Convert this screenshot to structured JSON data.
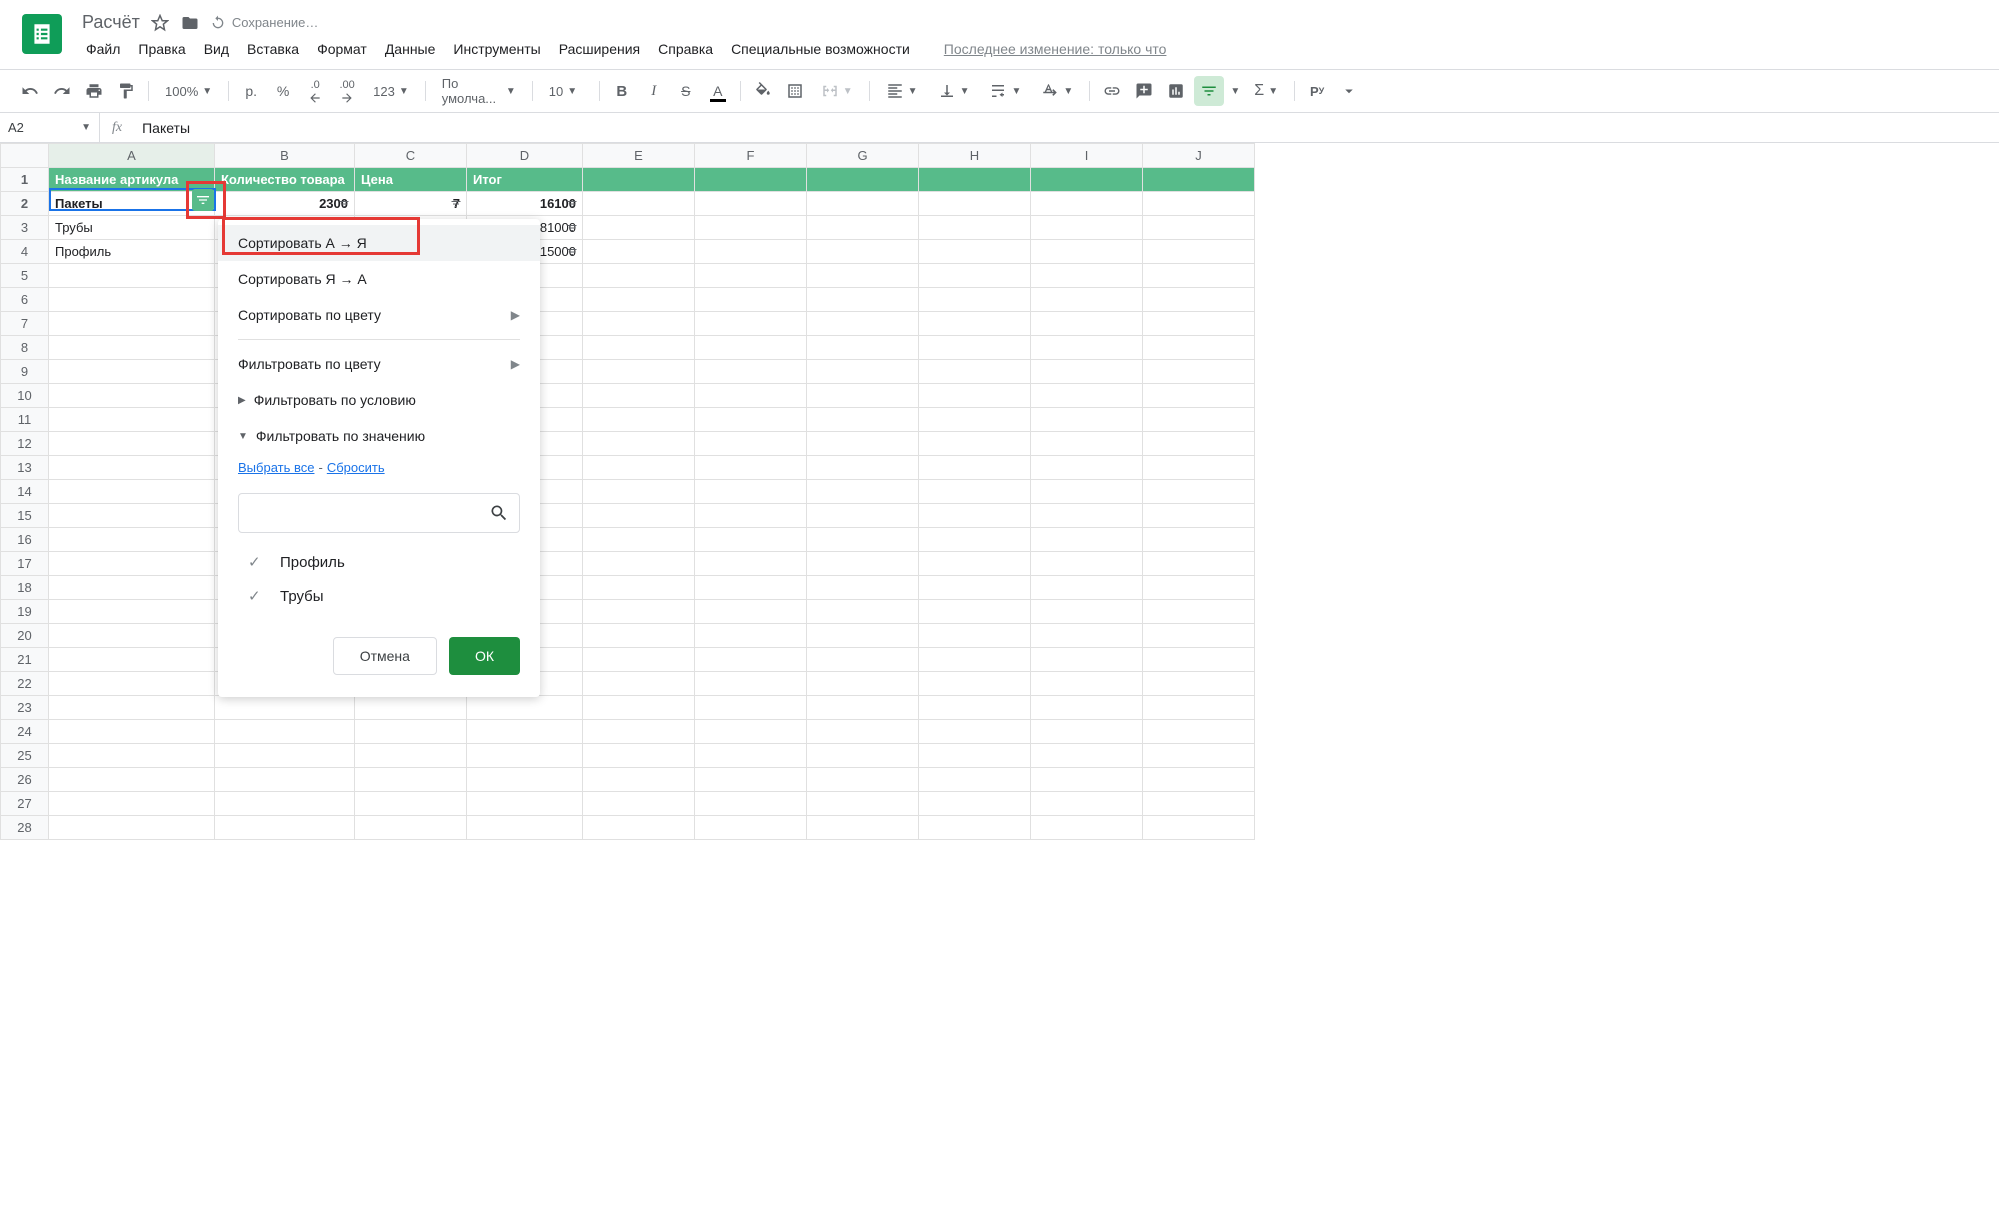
{
  "doc": {
    "title": "Расчёт",
    "saving": "Сохранение…",
    "last_change": "Последнее изменение: только что"
  },
  "menu": {
    "file": "Файл",
    "edit": "Правка",
    "view": "Вид",
    "insert": "Вставка",
    "format": "Формат",
    "data": "Данные",
    "tools": "Инструменты",
    "extensions": "Расширения",
    "help": "Справка",
    "accessibility": "Специальные возможности"
  },
  "toolbar": {
    "zoom": "100%",
    "currency": "р.",
    "percent": "%",
    "dec_less": ".0",
    "dec_more": ".00",
    "num_format": "123",
    "font": "По умолча...",
    "font_size": "10"
  },
  "formula_bar": {
    "cell_ref": "A2",
    "fx": "fx",
    "value": "Пакеты"
  },
  "columns": [
    "A",
    "B",
    "C",
    "D",
    "E",
    "F",
    "G",
    "H",
    "I",
    "J"
  ],
  "row_numbers": [
    1,
    2,
    3,
    4,
    5,
    6,
    7,
    8,
    9,
    10,
    11,
    12,
    13,
    14,
    15,
    16,
    17,
    18,
    19,
    20,
    21,
    22,
    23,
    24,
    25,
    26,
    27,
    28
  ],
  "sheet": {
    "headers": {
      "a": "Название артикула",
      "b": "Количество товара",
      "c": "Цена",
      "d": "Итог"
    },
    "rows": [
      {
        "a": "Пакеты",
        "b": "2300",
        "c": "7",
        "d": "16100",
        "bold": true
      },
      {
        "a": "Трубы",
        "b": "",
        "c": "",
        "d": "81000",
        "bold": false
      },
      {
        "a": "Профиль",
        "b": "",
        "c": "",
        "d": "115000",
        "bold": false
      }
    ]
  },
  "popup": {
    "sort_az": "Сортировать А → Я",
    "sort_za": "Сортировать Я → А",
    "sort_color": "Сортировать по цвету",
    "filter_color": "Фильтровать по цвету",
    "filter_condition": "Фильтровать по условию",
    "filter_value": "Фильтровать по значению",
    "select_all": "Выбрать все",
    "dash": "-",
    "reset": "Сбросить",
    "values": [
      {
        "label": "Профиль"
      },
      {
        "label": "Трубы"
      }
    ],
    "cancel": "Отмена",
    "ok": "ОК"
  }
}
